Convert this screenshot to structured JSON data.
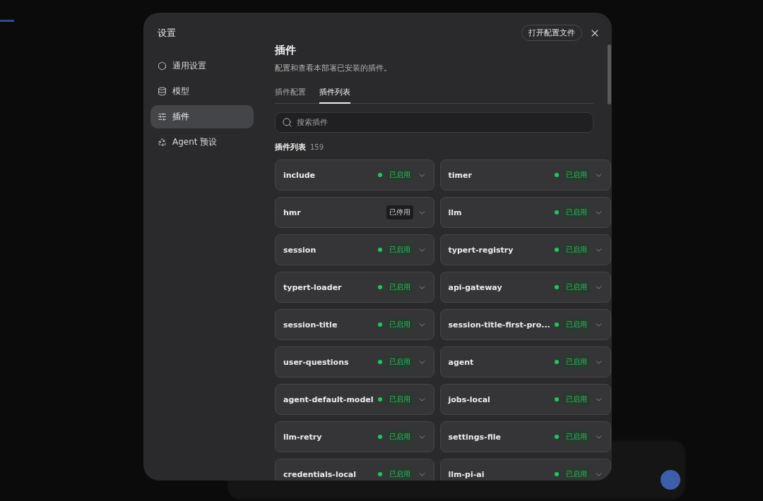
{
  "dialog": {
    "title": "设置",
    "open_config_button": "打开配置文件"
  },
  "sidebar": {
    "items": [
      {
        "label": "通用设置",
        "selected": false
      },
      {
        "label": "模型",
        "selected": false
      },
      {
        "label": "插件",
        "selected": true
      },
      {
        "label": "Agent 预设",
        "selected": false
      }
    ]
  },
  "panel": {
    "title": "插件",
    "description": "配置和查看本部署已安装的插件。",
    "tabs": [
      {
        "label": "插件配置",
        "selected": false
      },
      {
        "label": "插件列表",
        "selected": true
      }
    ],
    "search": {
      "placeholder": "搜索插件"
    },
    "list_title": "插件列表",
    "list_count": "159",
    "plugins": [
      {
        "name": "include",
        "enabled": true,
        "status": "已启用"
      },
      {
        "name": "timer",
        "enabled": true,
        "status": "已启用"
      },
      {
        "name": "hmr",
        "enabled": false,
        "status": "已停用"
      },
      {
        "name": "llm",
        "enabled": true,
        "status": "已启用"
      },
      {
        "name": "session",
        "enabled": true,
        "status": "已启用"
      },
      {
        "name": "typert-registry",
        "enabled": true,
        "status": "已启用"
      },
      {
        "name": "typert-loader",
        "enabled": true,
        "status": "已启用"
      },
      {
        "name": "api-gateway",
        "enabled": true,
        "status": "已启用"
      },
      {
        "name": "session-title",
        "enabled": true,
        "status": "已启用"
      },
      {
        "name": "session-title-first-pro...",
        "enabled": true,
        "status": "已启用"
      },
      {
        "name": "user-questions",
        "enabled": true,
        "status": "已启用"
      },
      {
        "name": "agent",
        "enabled": true,
        "status": "已启用"
      },
      {
        "name": "agent-default-model",
        "enabled": true,
        "status": "已启用"
      },
      {
        "name": "jobs-local",
        "enabled": true,
        "status": "已启用"
      },
      {
        "name": "llm-retry",
        "enabled": true,
        "status": "已启用"
      },
      {
        "name": "settings-file",
        "enabled": true,
        "status": "已启用"
      },
      {
        "name": "credentials-local",
        "enabled": true,
        "status": "已启用"
      },
      {
        "name": "llm-pi-ai",
        "enabled": true,
        "status": "已启用"
      }
    ]
  }
}
